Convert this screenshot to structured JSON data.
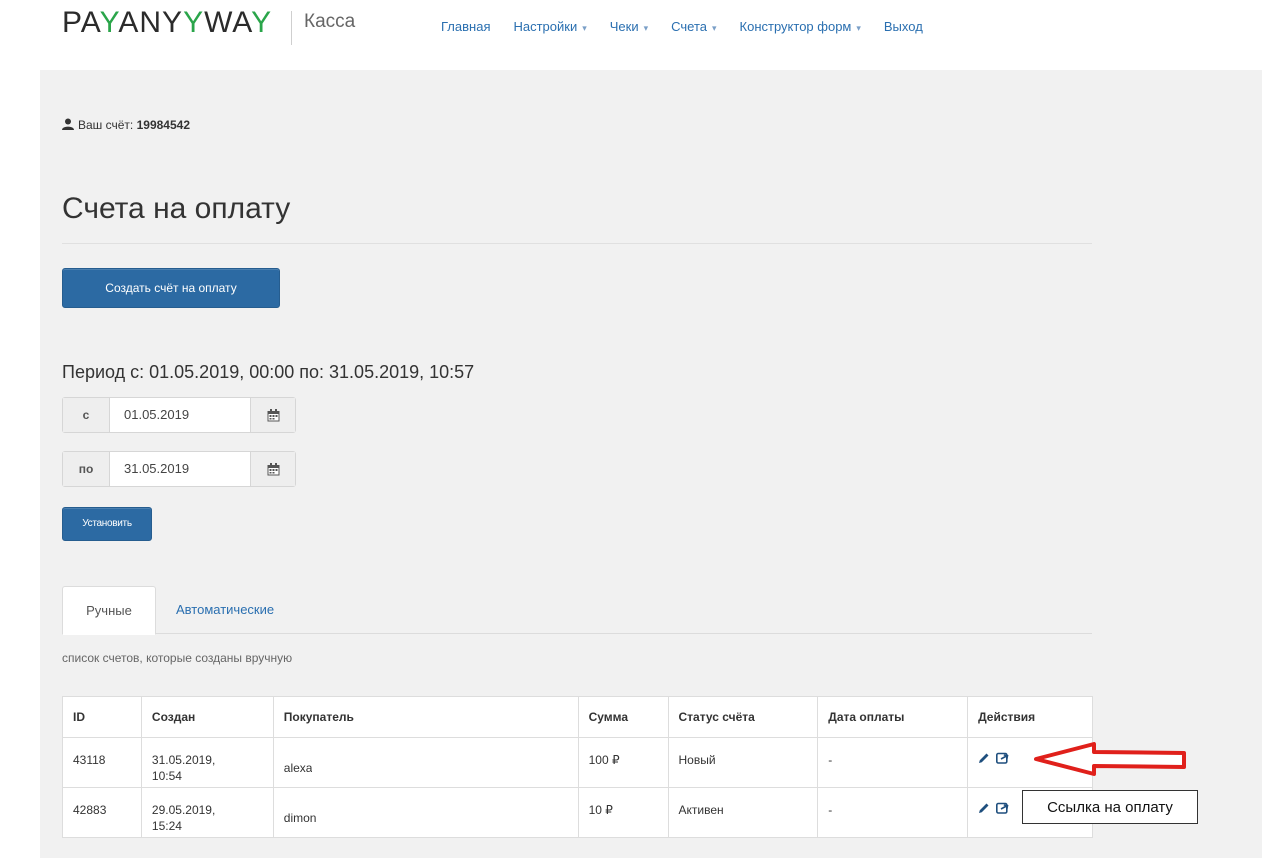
{
  "header": {
    "logo_text_1": "PA",
    "logo_y1": "Y",
    "logo_text_2": "ANY",
    "logo_y2": "Y",
    "logo_text_3": "WA",
    "logo_y3": "Y",
    "logo_sub": "Касса",
    "nav": [
      {
        "label": "Главная",
        "dropdown": false
      },
      {
        "label": "Настройки",
        "dropdown": true
      },
      {
        "label": "Чеки",
        "dropdown": true
      },
      {
        "label": "Счета",
        "dropdown": true
      },
      {
        "label": "Конструктор форм",
        "dropdown": true
      },
      {
        "label": "Выход",
        "dropdown": false
      }
    ]
  },
  "account": {
    "label": "Ваш счёт:",
    "number": "19984542"
  },
  "page_title": "Счета на оплату",
  "create_button": "Создать счёт на оплату",
  "period_text": "Период с: 01.05.2019, 00:00 по: 31.05.2019, 10:57",
  "date_from": {
    "addon": "с",
    "value": "01.05.2019"
  },
  "date_to": {
    "addon": "по",
    "value": "31.05.2019"
  },
  "set_button": "Установить",
  "tabs": [
    {
      "label": "Ручные",
      "active": true
    },
    {
      "label": "Автоматические",
      "active": false
    }
  ],
  "tab_description": "список счетов, которые созданы вручную",
  "table": {
    "headers": [
      "ID",
      "Создан",
      "Покупатель",
      "Сумма",
      "Статус счёта",
      "Дата оплаты",
      "Действия"
    ],
    "rows": [
      {
        "id": "43118",
        "created_date": "31.05.2019,",
        "created_time": "10:54",
        "customer": "alexa",
        "amount": "100 ₽",
        "status": "Новый",
        "paid": "-"
      },
      {
        "id": "42883",
        "created_date": "29.05.2019,",
        "created_time": "15:24",
        "customer": "dimon",
        "amount": "10 ₽",
        "status": "Активен",
        "paid": "-"
      }
    ]
  },
  "tooltip": "Ссылка на оплату",
  "colors": {
    "brand_green": "#2aa54a",
    "primary_button": "#2c6aa3",
    "link": "#2a6fb0",
    "annotation_red": "#e0201b"
  }
}
